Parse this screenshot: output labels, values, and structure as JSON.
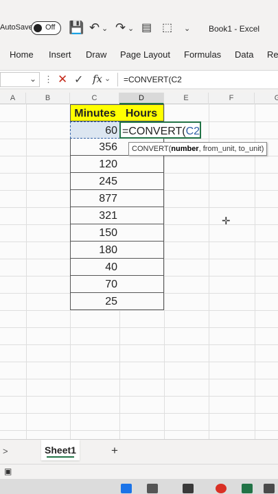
{
  "titlebar": {
    "autosave_label": "AutoSave",
    "autosave_state": "Off",
    "book_title": "Book1 - Excel"
  },
  "ribbon": {
    "tabs": [
      "Home",
      "Insert",
      "Draw",
      "Page Layout",
      "Formulas",
      "Data",
      "Re"
    ]
  },
  "formula_bar": {
    "cancel_icon": "✕",
    "enter_icon": "✓",
    "fx_label": "fx",
    "formula": "=CONVERT(C2"
  },
  "columns": [
    "A",
    "B",
    "C",
    "D",
    "E",
    "F",
    "G"
  ],
  "table": {
    "headers": [
      "Minutes",
      "Hours"
    ],
    "minutes": [
      "60",
      "356",
      "120",
      "245",
      "877",
      "321",
      "150",
      "180",
      "40",
      "70",
      "25"
    ],
    "editing_prefix": "=CONVERT(",
    "editing_ref": "C2"
  },
  "tooltip": {
    "fn": "CONVERT(",
    "arg_bold": "number",
    "rest": ", from_unit, to_unit)"
  },
  "sheets": {
    "nav": ">",
    "active": "Sheet1",
    "add": "+"
  },
  "colors": {
    "header_fill": "#ffff00",
    "excel_green": "#217346",
    "ref_blue": "#2f5fa5",
    "cancel_red": "#c42b1c"
  }
}
